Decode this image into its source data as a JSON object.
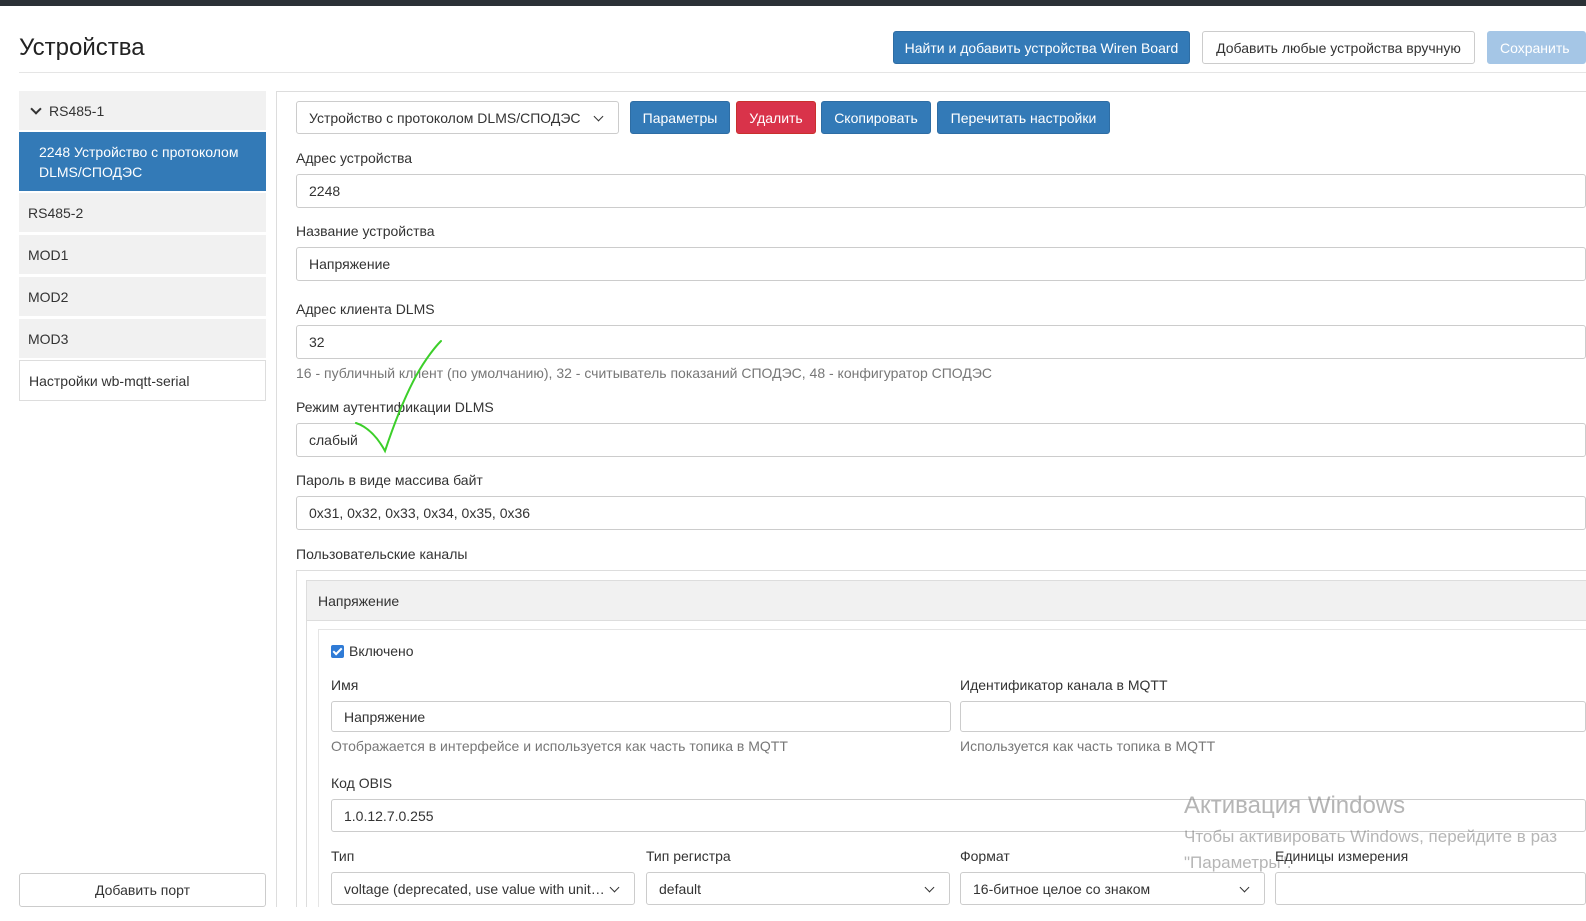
{
  "header": {
    "title": "Устройства",
    "find_add_button": "Найти и добавить устройства Wiren Board",
    "add_manual_button": "Добавить любые устройства вручную",
    "save_button": "Сохранить"
  },
  "sidebar": {
    "items": [
      {
        "label": "RS485-1"
      },
      {
        "label": "2248 Устройство с протоколом DLMS/СПОДЭС"
      },
      {
        "label": "RS485-2"
      },
      {
        "label": "MOD1"
      },
      {
        "label": "MOD2"
      },
      {
        "label": "MOD3"
      },
      {
        "label": "Настройки wb-mqtt-serial"
      }
    ],
    "add_port_button": "Добавить порт"
  },
  "toolbar": {
    "device_type_select": "Устройство с протоколом DLMS/СПОДЭС",
    "params_button": "Параметры",
    "delete_button": "Удалить",
    "copy_button": "Скопировать",
    "reread_button": "Перечитать настройки"
  },
  "form": {
    "address_label": "Адрес устройства",
    "address_value": "2248",
    "name_label": "Название устройства",
    "name_value": "Напряжение",
    "dlms_client_label": "Адрес клиента DLMS",
    "dlms_client_value": "32",
    "dlms_client_help": "16 - публичный клиент (по умолчанию), 32 - считыватель показаний СПОДЭС, 48 - конфигуратор СПОДЭС",
    "auth_label": "Режим аутентификации DLMS",
    "auth_value": "слабый",
    "password_label": "Пароль в виде массива байт",
    "password_value": "0x31, 0x32, 0x33, 0x34, 0x35, 0x36",
    "channels_label": "Пользовательские каналы"
  },
  "channel": {
    "header": "Напряжение",
    "enabled_label": "Включено",
    "enabled": true,
    "name_label": "Имя",
    "name_value": "Напряжение",
    "name_help": "Отображается в интерфейсе и используется как часть топика в MQTT",
    "mqtt_id_label": "Идентификатор канала в MQTT",
    "mqtt_id_value": "",
    "mqtt_id_help": "Используется как часть топика в MQTT",
    "obis_label": "Код OBIS",
    "obis_value": "1.0.12.7.0.255",
    "type_label": "Тип",
    "type_value": "voltage (deprecated, use value with unit…",
    "register_type_label": "Тип регистра",
    "register_type_value": "default",
    "format_label": "Формат",
    "format_value": "16-битное целое со знаком",
    "units_label": "Единицы измерения",
    "units_value": ""
  },
  "watermark": {
    "title": "Активация Windows",
    "line1": "Чтобы активировать Windows, перейдите в раз",
    "line2": "\"Параметры\"."
  },
  "colors": {
    "primary": "#337ab7",
    "danger": "#d9334a",
    "sidebar_bg": "#f1f1f1",
    "annotation_check": "#3ccf2a"
  }
}
